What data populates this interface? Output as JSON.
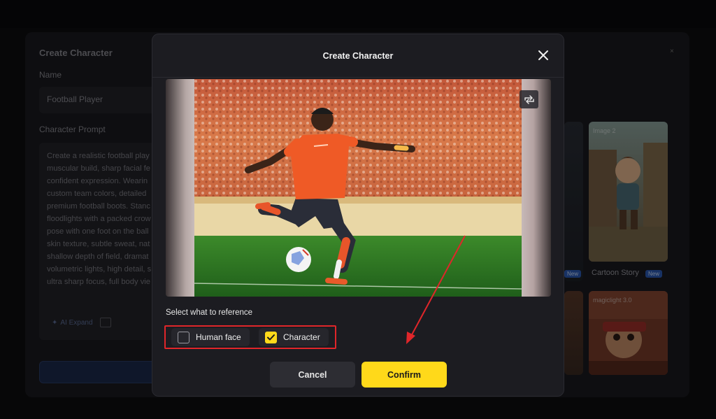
{
  "background": {
    "panel_title": "Create Character",
    "name_label": "Name",
    "name_value": "Football Player",
    "prompt_label": "Character Prompt",
    "prompt_lines": [
      "Create a realistic football play",
      "muscular build, sharp facial fe",
      "confident expression. Wearin",
      "custom team colors, detailed",
      "premium football boots. Stanc",
      "floodlights with a packed crow",
      "pose with one foot on the ball",
      "skin texture, subtle sweat, nat",
      "shallow depth of field, dramat",
      "volumetric lights, high detail, s",
      "ultra sharp focus, full body vie"
    ],
    "ai_expand_label": "AI Expand",
    "cards": [
      {
        "tag": "Image 2",
        "label": "Cartoon Story",
        "badge": "New"
      },
      {
        "tag": "magiclight 3.0",
        "label": "",
        "badge": ""
      }
    ],
    "left_card_badge": "New"
  },
  "modal": {
    "title": "Create Character",
    "reference_label": "Select what to reference",
    "options": [
      {
        "label": "Human face",
        "checked": false
      },
      {
        "label": "Character",
        "checked": true
      }
    ],
    "cancel_label": "Cancel",
    "confirm_label": "Confirm"
  },
  "colors": {
    "accent": "#ffd91a",
    "annotation": "#e0262a",
    "modal_bg": "#1c1c21"
  },
  "icons": [
    "close-icon",
    "swap-icon",
    "checkmark-icon",
    "ai-expand-icon",
    "image-icon"
  ]
}
